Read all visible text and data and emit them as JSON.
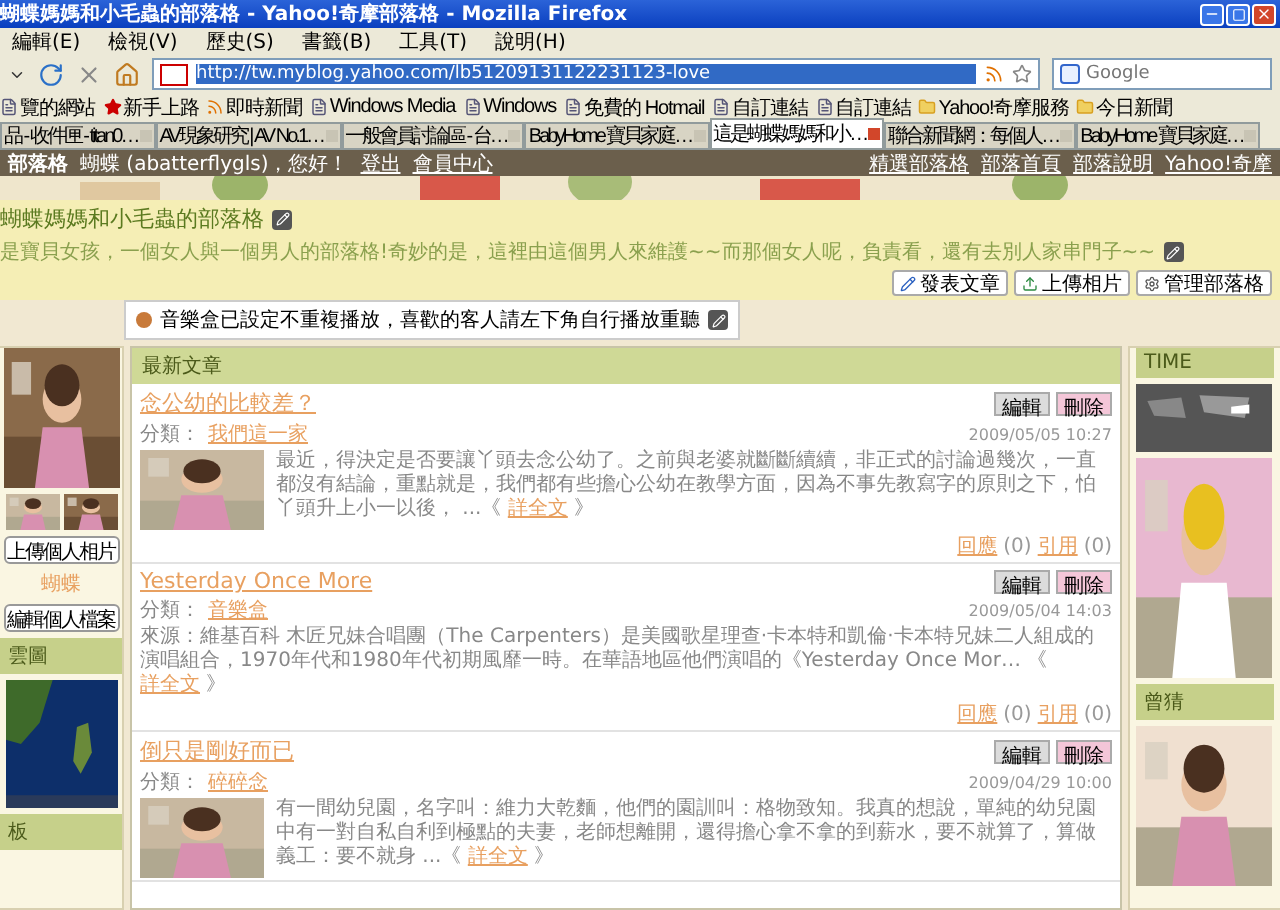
{
  "window": {
    "title": "蝴蝶媽媽和小毛蟲的部落格 - Yahoo!奇摩部落格 - Mozilla Firefox"
  },
  "menu": [
    "編輯(E)",
    "檢視(V)",
    "歷史(S)",
    "書籤(B)",
    "工具(T)",
    "說明(H)"
  ],
  "address": {
    "value": "http://tw.myblog.yahoo.com/lb51209131122231123-love"
  },
  "search": {
    "placeholder": "Google"
  },
  "bookmarks": [
    {
      "label": "覽的網站",
      "kind": "page"
    },
    {
      "label": "新手上路",
      "kind": "start"
    },
    {
      "label": "即時新聞",
      "kind": "feed"
    },
    {
      "label": "Windows Media",
      "kind": "page"
    },
    {
      "label": "Windows",
      "kind": "page"
    },
    {
      "label": "免費的 Hotmail",
      "kind": "page"
    },
    {
      "label": "自訂連結",
      "kind": "page"
    },
    {
      "label": "自訂連結",
      "kind": "page"
    },
    {
      "label": "Yahoo!奇摩服務",
      "kind": "folder"
    },
    {
      "label": "今日新聞",
      "kind": "folder"
    }
  ],
  "tabs": [
    {
      "label": "品 - 收件匣 - titan0…",
      "selected": false
    },
    {
      "label": "AV現象研究 | AV No.1…",
      "selected": false
    },
    {
      "label": "一般會員討論區 - 台…",
      "selected": false
    },
    {
      "label": "BabyHome 寶貝家庭…",
      "selected": false
    },
    {
      "label": "這是蝴蝶媽媽和小…",
      "selected": true
    },
    {
      "label": "聯合新聞網：每個人…",
      "selected": false
    },
    {
      "label": "BabyHome 寶貝家庭…",
      "selected": false
    }
  ],
  "blog": {
    "brand": "部落格",
    "greeting": "蝴蝶 (abatterflygls)，您好！",
    "user_links": [
      "登出",
      "會員中心"
    ],
    "right_links": [
      "精選部落格",
      "部落首頁",
      "部落說明",
      "Yahoo!奇摩"
    ],
    "title": "蝴蝶媽媽和小毛蟲的部落格",
    "description": "是寶貝女孩，一個女人與一個男人的部落格!奇妙的是，這裡由這個男人來維護~~而那個女人呢，負責看，還有去別人家串門子~~",
    "actions": [
      "發表文章",
      "上傳相片",
      "管理部落格"
    ],
    "notice": "音樂盒已設定不重複播放，喜歡的客人請左下角自行播放重聽"
  },
  "sidebar": {
    "upload_button": "上傳個人相片",
    "name": "蝴蝶",
    "edit_button": "編輯個人檔案",
    "panels": [
      "雲圖",
      "板"
    ]
  },
  "main": {
    "heading": "最新文章",
    "posts": [
      {
        "title": "念公幼的比較差？",
        "category_label": "分類：",
        "category": "我們這一家",
        "date": "2009/05/05 10:27",
        "edit": "編輯",
        "delete": "刪除",
        "has_thumb": true,
        "excerpt": "最近，得決定是否要讓丫頭去念公幼了。之前與老婆就斷斷續續，非正式的討論過幾次，一直都沒有結論，重點就是，我們都有些擔心公幼在教學方面，因為不事先教寫字的原則之下，怕丫頭升上小一以後，  ...《",
        "more": "詳全文",
        "more_end": "》",
        "comments": "回應",
        "comments_count": "(0)",
        "trackbacks": "引用",
        "trackbacks_count": "(0)"
      },
      {
        "title": "Yesterday Once More",
        "category_label": "分類：",
        "category": "音樂盒",
        "date": "2009/05/04 14:03",
        "edit": "編輯",
        "delete": "刪除",
        "has_thumb": false,
        "excerpt": "來源：維基百科 木匠兄妹合唱團（The Carpenters）是美國歌星理查·卡本特和凱倫·卡本特兄妹二人組成的演唱組合，1970年代和1980年代初期風靡一時。在華語地區他們演唱的《Yesterday Once Mor… 《",
        "more": "詳全文",
        "more_end": "》",
        "comments": "回應",
        "comments_count": "(0)",
        "trackbacks": "引用",
        "trackbacks_count": "(0)"
      },
      {
        "title": "倒只是剛好而已",
        "category_label": "分類：",
        "category": "碎碎念",
        "date": "2009/04/29 10:00",
        "edit": "編輯",
        "delete": "刪除",
        "has_thumb": true,
        "excerpt": "有一間幼兒園，名字叫：維力大乾麵，他們的園訓叫：格物致知。我真的想說，單純的幼兒園中有一對自私自利到極點的夫妻，老師想離開，還得擔心拿不拿的到薪水，要不就算了，算做義工：要不就身 ...《",
        "more": "詳全文",
        "more_end": "》"
      }
    ]
  },
  "right": {
    "panels": [
      "TIME",
      "曾猜"
    ]
  }
}
